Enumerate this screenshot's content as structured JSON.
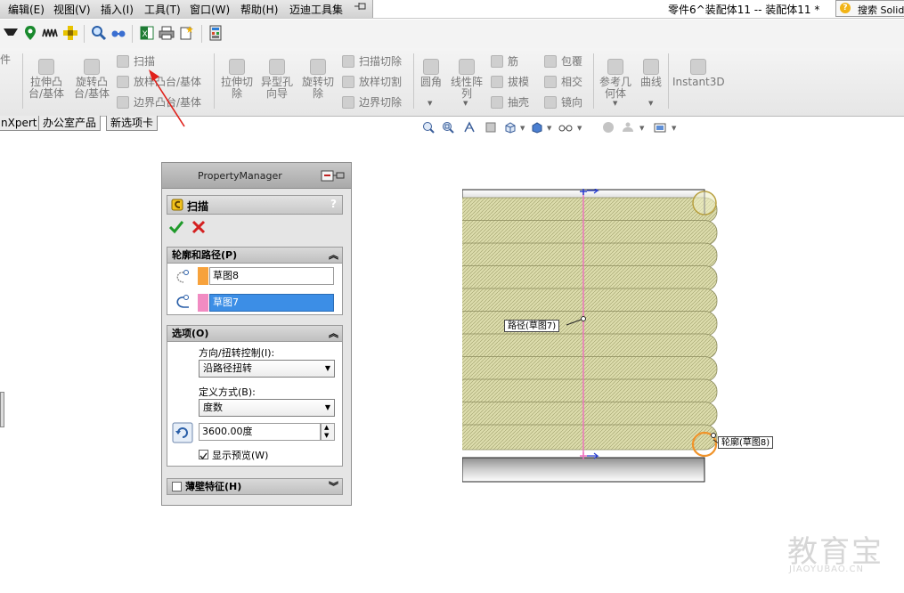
{
  "menu": {
    "items": [
      "编辑(E)",
      "视图(V)",
      "插入(I)",
      "工具(T)",
      "窗口(W)",
      "帮助(H)",
      "迈迪工具集"
    ],
    "doc_title": "零件6^装配体11 -- 装配体11 *",
    "search": "搜索 SolidW"
  },
  "commands": {
    "partial_left": "件",
    "extrude_boss": [
      "拉伸凸",
      "台/基体"
    ],
    "revolve_boss": [
      "旋转凸",
      "台/基体"
    ],
    "sweep": "扫描",
    "loft": "放样凸台/基体",
    "boundary": "边界凸台/基体",
    "extrude_cut": [
      "拉伸切",
      "除"
    ],
    "hole_wizard": [
      "异型孔",
      "向导"
    ],
    "revolve_cut": [
      "旋转切",
      "除"
    ],
    "sweep_cut": "扫描切除",
    "loft_cut": "放样切割",
    "boundary_cut": "边界切除",
    "fillet": "圆角",
    "linear_pattern": [
      "线性阵",
      "列"
    ],
    "rib": "筋",
    "draft": "拔模",
    "shell": "抽壳",
    "wrap": "包覆",
    "intersect": "相交",
    "mirror": "镜向",
    "ref_geometry": [
      "参考几",
      "何体"
    ],
    "curves": "曲线",
    "instant3d": "Instant3D"
  },
  "tabs": [
    "nXpert",
    "办公室产品",
    "新选项卡"
  ],
  "property_manager": {
    "header": "PropertyManager",
    "feature_title": "扫描",
    "help": "?",
    "profile_section": {
      "title": "轮廓和路径(P)",
      "profile_value": "草图8",
      "path_value": "草图7",
      "profile_color": "#f7a23c",
      "path_color": "#f18bc2"
    },
    "options_section": {
      "title": "选项(O)",
      "orientation_label": "方向/扭转控制(I):",
      "orientation_value": "沿路径扭转",
      "define_by_label": "定义方式(B):",
      "define_by_value": "度数",
      "angle_value": "3600.00度",
      "show_preview_label": "显示预览(W)"
    },
    "thin_section": {
      "title": "薄壁特征(H)"
    }
  },
  "graphics": {
    "path_callout": "路径(草图7)",
    "profile_callout": "轮廓(草图8)",
    "spring_color": "#dcdcac"
  },
  "watermark": {
    "cn": "教育宝",
    "en": "JIAOYUBAO.CN"
  }
}
